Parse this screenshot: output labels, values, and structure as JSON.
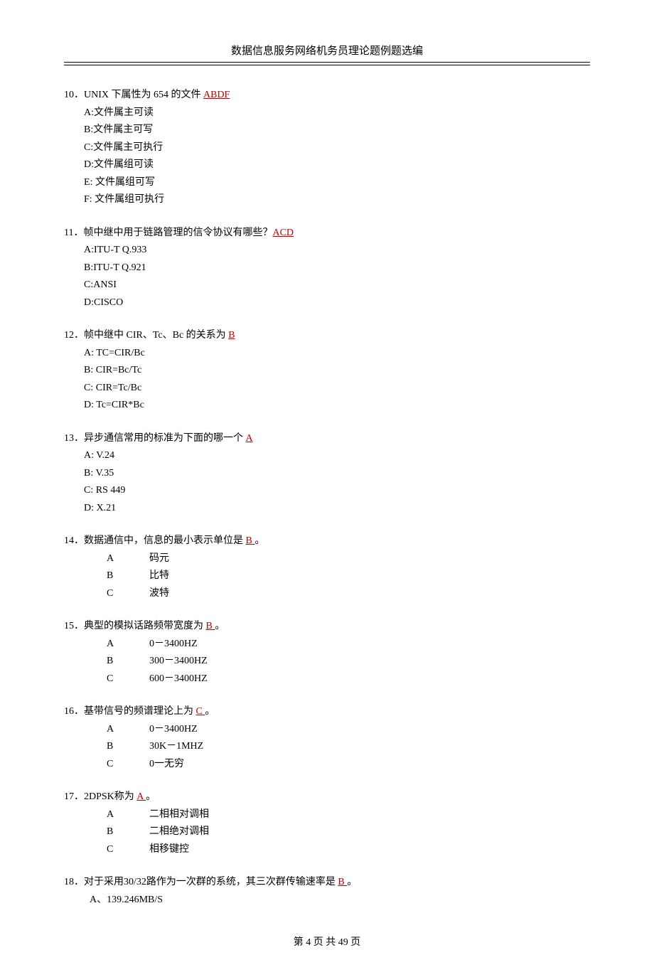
{
  "header": "数据信息服务网络机务员理论题例题选编",
  "questions": [
    {
      "num": "10．",
      "text": "UNIX 下属性为 654 的文件 ",
      "answer": "ABDF",
      "opts_simple": [
        "A:文件属主可读",
        "B:文件属主可写",
        "C:文件属主可执行",
        "D:文件属组可读",
        "E:  文件属组可写",
        "F:  文件属组可执行"
      ]
    },
    {
      "num": "11．",
      "text": "帧中继中用于链路管理的信令协议有哪些？",
      "answer": "ACD",
      "opts_simple": [
        "A:ITU-T Q.933",
        "B:ITU-T Q.921",
        "C:ANSI",
        "D:CISCO"
      ]
    },
    {
      "num": "12．",
      "text": "帧中继中 CIR、Tc、Bc 的关系为 ",
      "answer": "B",
      "opts_simple": [
        "A: TC=CIR/Bc",
        "B: CIR=Bc/Tc",
        "C: CIR=Tc/Bc",
        "D: Tc=CIR*Bc"
      ]
    },
    {
      "num": "13．",
      "text": "异步通信常用的标准为下面的哪一个 ",
      "answer": "A",
      "opts_simple": [
        "A: V.24",
        "B: V.35",
        "C: RS 449",
        "D: X.21"
      ]
    },
    {
      "num": "14．",
      "text": "数据通信中，信息的最小表示单位是 ",
      "answer": "  B  ",
      "after": " 。",
      "opts_tab": [
        {
          "letter": "A",
          "val": "码元"
        },
        {
          "letter": "B",
          "val": "比特"
        },
        {
          "letter": "C",
          "val": "波特"
        }
      ]
    },
    {
      "num": "15．",
      "text": "典型的模拟话路频带宽度为 ",
      "answer": "  B   ",
      "after": " 。",
      "opts_tab": [
        {
          "letter": "A",
          "val": "0－3400HZ"
        },
        {
          "letter": "B",
          "val": "300－3400HZ"
        },
        {
          "letter": "C",
          "val": "600－3400HZ"
        }
      ]
    },
    {
      "num": "16．",
      "text": "基带信号的频谱理论上为 ",
      "answer": "  C   ",
      "after": "  。",
      "opts_tab": [
        {
          "letter": "A",
          "val": "0－3400HZ"
        },
        {
          "letter": "B",
          "val": "30K－1MHZ"
        },
        {
          "letter": "C",
          "val": "0一无穷"
        }
      ]
    },
    {
      "num": "17．",
      "text": "2DPSK称为 ",
      "answer": "  A   ",
      "after": " 。",
      "opts_tab": [
        {
          "letter": "A",
          "val": "二相相对调相"
        },
        {
          "letter": "B",
          "val": "二相绝对调相"
        },
        {
          "letter": "C",
          "val": "相移键控"
        }
      ]
    },
    {
      "num": "18．",
      "text": "对于采用30/32路作为一次群的系统，其三次群传输速率是 ",
      "answer": "  B  ",
      "after": " 。",
      "opts_simple": [
        "A、139.246MB/S"
      ],
      "indent_opts": true
    }
  ],
  "footer": {
    "prefix": "第 ",
    "page": "4",
    "mid": " 页 共 ",
    "total": "49",
    "suffix": " 页"
  }
}
